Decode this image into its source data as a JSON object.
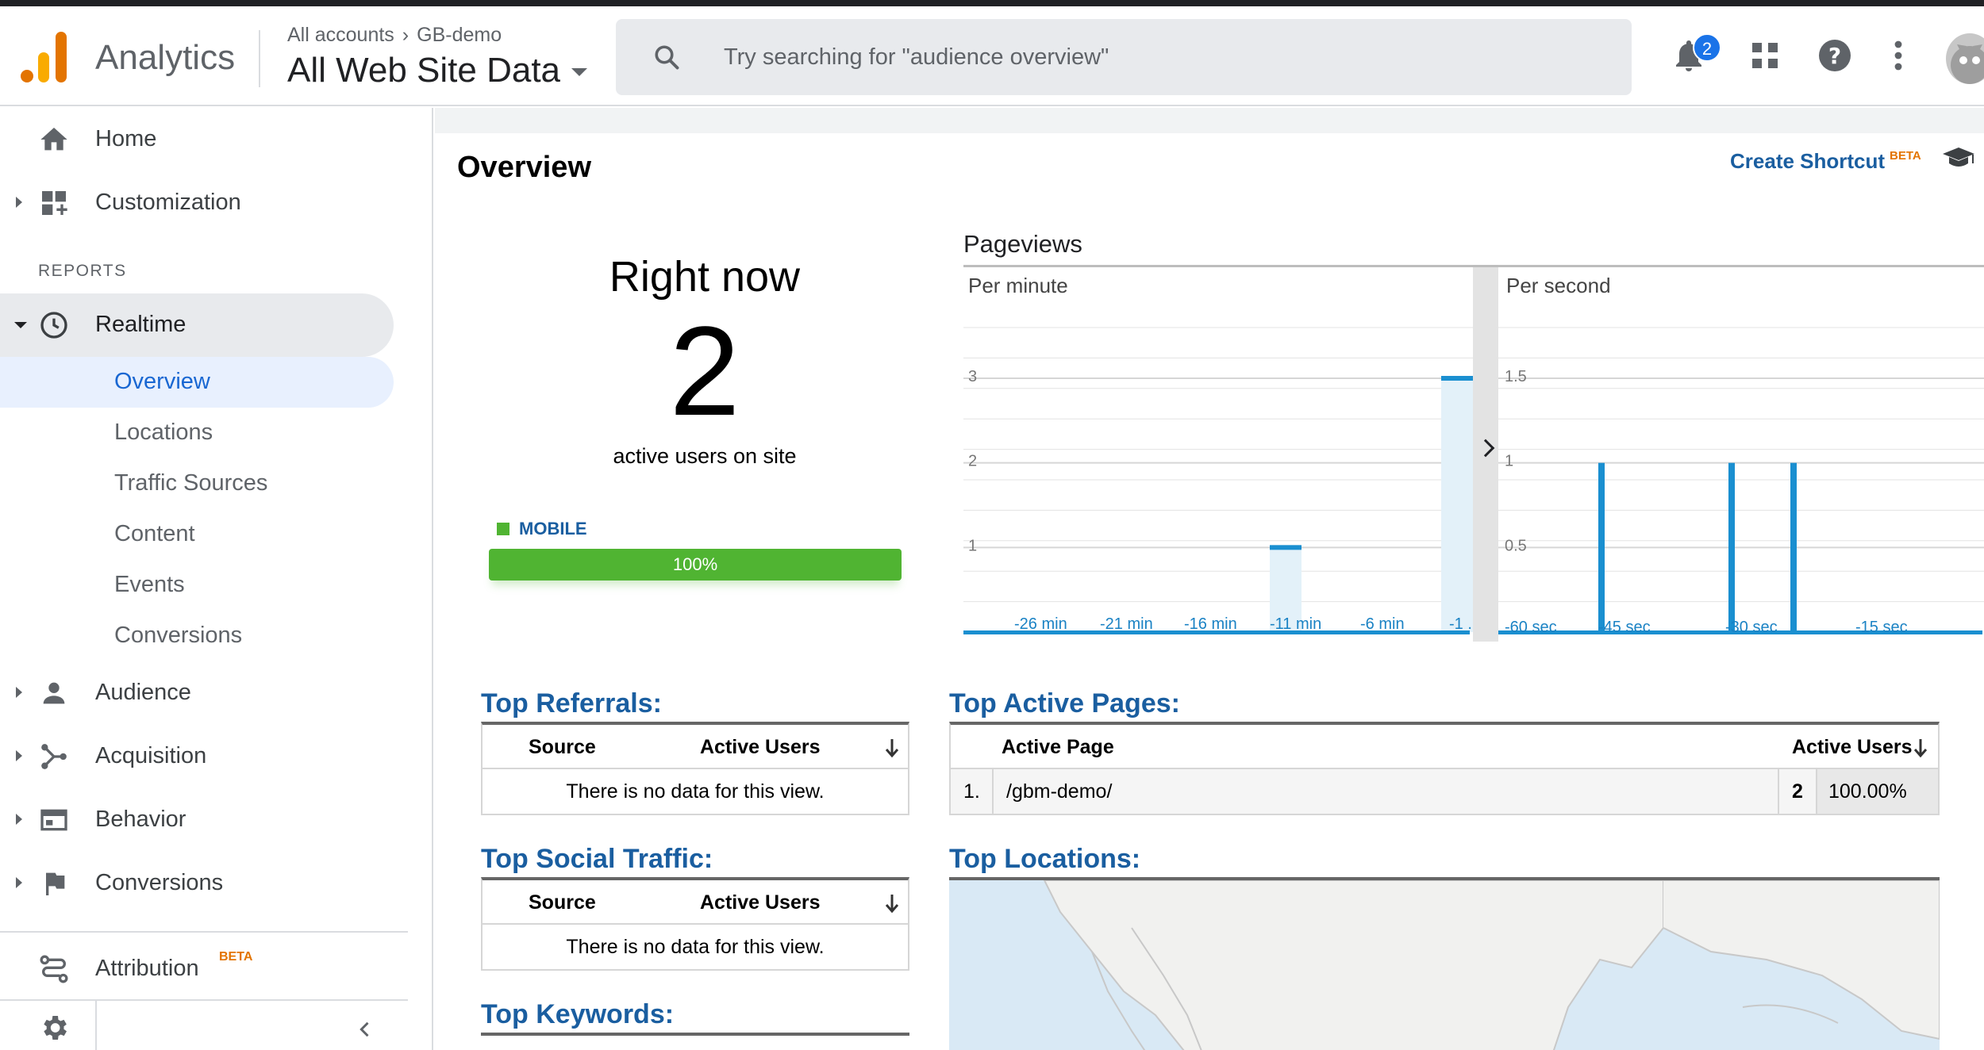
{
  "header": {
    "app_name": "Analytics",
    "breadcrumb_account": "All accounts",
    "breadcrumb_property": "GB-demo",
    "view_name": "All Web Site Data",
    "search_placeholder": "Try searching for \"audience overview\"",
    "notification_count": "2"
  },
  "sidebar": {
    "home": "Home",
    "customization": "Customization",
    "reports_header": "REPORTS",
    "realtime": "Realtime",
    "realtime_items": [
      "Overview",
      "Locations",
      "Traffic Sources",
      "Content",
      "Events",
      "Conversions"
    ],
    "audience": "Audience",
    "acquisition": "Acquisition",
    "behavior": "Behavior",
    "conversions": "Conversions",
    "attribution": "Attribution",
    "attribution_badge": "BETA"
  },
  "main": {
    "title": "Overview",
    "create_shortcut": "Create Shortcut",
    "create_shortcut_badge": "BETA",
    "right_now": {
      "title": "Right now",
      "count": "2",
      "caption": "active users on site",
      "device_label": "MOBILE",
      "device_percent": "100%",
      "device_share": 1.0
    },
    "pageviews": {
      "title": "Pageviews",
      "per_minute": "Per minute",
      "per_second": "Per second"
    },
    "top_referrals": {
      "title": "Top Referrals:",
      "col_source": "Source",
      "col_users": "Active Users",
      "empty": "There is no data for this view."
    },
    "top_social": {
      "title": "Top Social Traffic:",
      "col_source": "Source",
      "col_users": "Active Users",
      "empty": "There is no data for this view."
    },
    "top_keywords": {
      "title": "Top Keywords:"
    },
    "top_active_pages": {
      "title": "Top Active Pages:",
      "col_page": "Active Page",
      "col_users": "Active Users",
      "rows": [
        {
          "rank": "1.",
          "page": "/gbm-demo/",
          "users": "2",
          "percent": "100.00%"
        }
      ]
    },
    "top_locations": {
      "title": "Top Locations:"
    }
  },
  "chart_data": [
    {
      "type": "bar",
      "title": "Per minute",
      "x_ticks": [
        "-26 min",
        "-21 min",
        "-16 min",
        "-11 min",
        "-6 min",
        "-1 ..."
      ],
      "y_ticks": [
        "1",
        "2",
        "3"
      ],
      "ylim": [
        0,
        3
      ],
      "categories": [
        "-11 min",
        "-1 min"
      ],
      "values": [
        1,
        3
      ]
    },
    {
      "type": "bar",
      "title": "Per second",
      "x_ticks": [
        "-60 sec",
        "-45 sec",
        "-30 sec",
        "-15 sec"
      ],
      "y_ticks": [
        "0.5",
        "1",
        "1.5"
      ],
      "ylim": [
        0,
        1.5
      ],
      "categories": [
        "-49 sec",
        "-32 sec",
        "-28 sec"
      ],
      "values": [
        1,
        1,
        1
      ]
    }
  ]
}
